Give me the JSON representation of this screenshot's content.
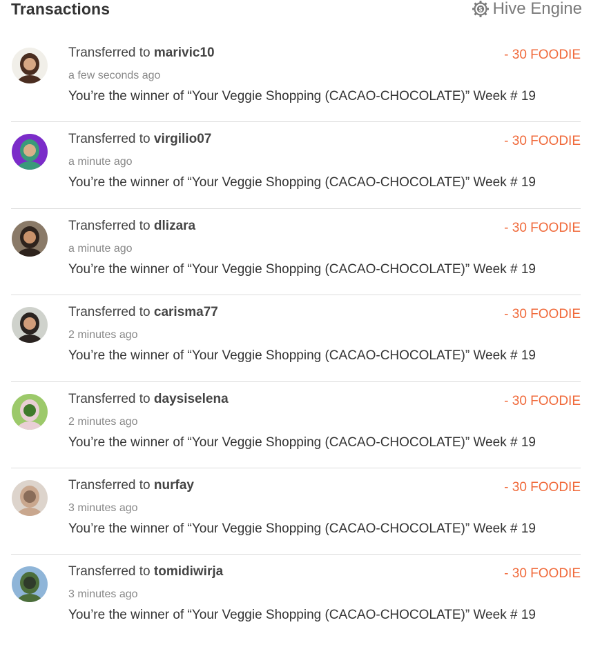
{
  "header": {
    "title": "Transactions",
    "engine_label": "Hive Engine",
    "engine_icon": "hive-engine-gear-icon"
  },
  "colors": {
    "amount": "#f06a3b",
    "divider": "#dcdcdc",
    "muted": "#888888"
  },
  "transactions": [
    {
      "prefix": "Transferred to",
      "user": "marivic10",
      "time": "a few seconds ago",
      "amount": "- 30 FOODIE",
      "memo": "You’re the winner of “Your Veggie Shopping (CACAO-CHOCOLATE)” Week # 19",
      "avatar_colors": [
        "#f1efe9",
        "#4a2d20",
        "#d7a784"
      ]
    },
    {
      "prefix": "Transferred to",
      "user": "virgilio07",
      "time": "a minute ago",
      "amount": "- 30 FOODIE",
      "memo": "You’re the winner of “Your Veggie Shopping (CACAO-CHOCOLATE)” Week # 19",
      "avatar_colors": [
        "#7b2cc9",
        "#3a9a7a",
        "#d8b08a"
      ]
    },
    {
      "prefix": "Transferred to",
      "user": "dlizara",
      "time": "a minute ago",
      "amount": "- 30 FOODIE",
      "memo": "You’re the winner of “Your Veggie Shopping (CACAO-CHOCOLATE)” Week # 19",
      "avatar_colors": [
        "#8a7a68",
        "#2e231d",
        "#c9926b"
      ]
    },
    {
      "prefix": "Transferred to",
      "user": "carisma77",
      "time": "2 minutes ago",
      "amount": "- 30 FOODIE",
      "memo": "You’re the winner of “Your Veggie Shopping (CACAO-CHOCOLATE)” Week # 19",
      "avatar_colors": [
        "#cfd2cc",
        "#2a2320",
        "#d29d7a"
      ]
    },
    {
      "prefix": "Transferred to",
      "user": "daysiselena",
      "time": "2 minutes ago",
      "amount": "- 30 FOODIE",
      "memo": "You’re the winner of “Your Veggie Shopping (CACAO-CHOCOLATE)” Week # 19",
      "avatar_colors": [
        "#9cc96a",
        "#e9cfd5",
        "#3f7a2b"
      ]
    },
    {
      "prefix": "Transferred to",
      "user": "nurfay",
      "time": "3 minutes ago",
      "amount": "- 30 FOODIE",
      "memo": "You’re the winner of “Your Veggie Shopping (CACAO-CHOCOLATE)” Week # 19",
      "avatar_colors": [
        "#ddd4cc",
        "#c9a78e",
        "#8a6d5a"
      ]
    },
    {
      "prefix": "Transferred to",
      "user": "tomidiwirja",
      "time": "3 minutes ago",
      "amount": "- 30 FOODIE",
      "memo": "You’re the winner of “Your Veggie Shopping (CACAO-CHOCOLATE)” Week # 19",
      "avatar_colors": [
        "#8fb5d8",
        "#4c6e3a",
        "#2f3a2a"
      ]
    }
  ]
}
